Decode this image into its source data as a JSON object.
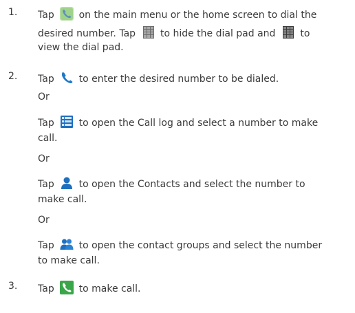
{
  "steps": [
    {
      "number": "1.",
      "lines": [
        [
          "Tap",
          "on the main menu or the home screen to dial the"
        ],
        [
          "desired number. Tap",
          "to hide the dial pad and",
          "to"
        ],
        [
          "view the dial pad."
        ]
      ]
    },
    {
      "number": "2.",
      "line1": [
        "Tap",
        "to enter the desired number to be dialed."
      ],
      "or": "Or",
      "opt_calllog": [
        "Tap",
        "to open the Call log and select a number to make",
        "call."
      ],
      "opt_contacts": [
        "Tap",
        "to open the Contacts and select the number to",
        "make call."
      ],
      "opt_groups": [
        "Tap",
        "to open the contact groups and select the number",
        "to make call."
      ]
    },
    {
      "number": "3.",
      "line1": [
        "Tap",
        "to make call."
      ]
    }
  ],
  "icons": {
    "phone_app": "phone-app-icon",
    "dialpad_hide": "dialpad-hide-icon",
    "dialpad_show": "dialpad-show-icon",
    "dialer": "dialer-icon",
    "call_log": "call-log-icon",
    "contacts": "contacts-icon",
    "contact_groups": "contact-groups-icon",
    "call": "call-icon"
  },
  "colors": {
    "text": "#3a3a3a",
    "accent_blue": "#1e78c8",
    "accent_green": "#3aa64a"
  }
}
